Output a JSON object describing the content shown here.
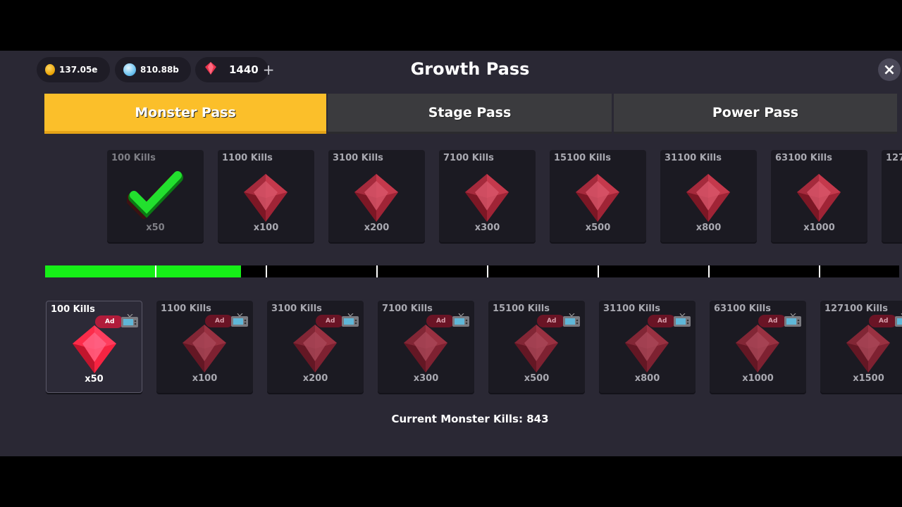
{
  "currencies": {
    "gold": {
      "value": "137.05e",
      "icon": "gold-coin-icon",
      "color": "#f5b400"
    },
    "pearl": {
      "value": "810.88b",
      "icon": "pearl-orb-icon",
      "color": "#6fc4f0"
    },
    "gem": {
      "value": "1440",
      "icon": "red-gem-icon",
      "plus": "+"
    }
  },
  "title": "Growth Pass",
  "close_label": "×",
  "tabs": [
    {
      "label": "Monster Pass",
      "selected": true
    },
    {
      "label": "Stage Pass",
      "selected": false
    },
    {
      "label": "Power Pass",
      "selected": false
    }
  ],
  "free_rewards": [
    {
      "kills": "100 Kills",
      "amount": "x50",
      "claimed": true
    },
    {
      "kills": "1100 Kills",
      "amount": "x100"
    },
    {
      "kills": "3100 Kills",
      "amount": "x200"
    },
    {
      "kills": "7100 Kills",
      "amount": "x300"
    },
    {
      "kills": "15100 Kills",
      "amount": "x500"
    },
    {
      "kills": "31100 Kills",
      "amount": "x800"
    },
    {
      "kills": "63100 Kills",
      "amount": "x1000"
    },
    {
      "kills": "127"
    }
  ],
  "ad_label": "Ad",
  "ad_rewards": [
    {
      "kills": "100 Kills",
      "amount": "x50",
      "available": true
    },
    {
      "kills": "1100 Kills",
      "amount": "x100"
    },
    {
      "kills": "3100 Kills",
      "amount": "x200"
    },
    {
      "kills": "7100 Kills",
      "amount": "x300"
    },
    {
      "kills": "15100 Kills",
      "amount": "x500"
    },
    {
      "kills": "31100 Kills",
      "amount": "x800"
    },
    {
      "kills": "63100 Kills",
      "amount": "x1000"
    },
    {
      "kills": "127100 Kills",
      "amount": "x1500"
    }
  ],
  "progress": {
    "segments_filled": 1.77,
    "color": "#16ef17"
  },
  "current_kills_text": "Current Monster Kills: 843"
}
